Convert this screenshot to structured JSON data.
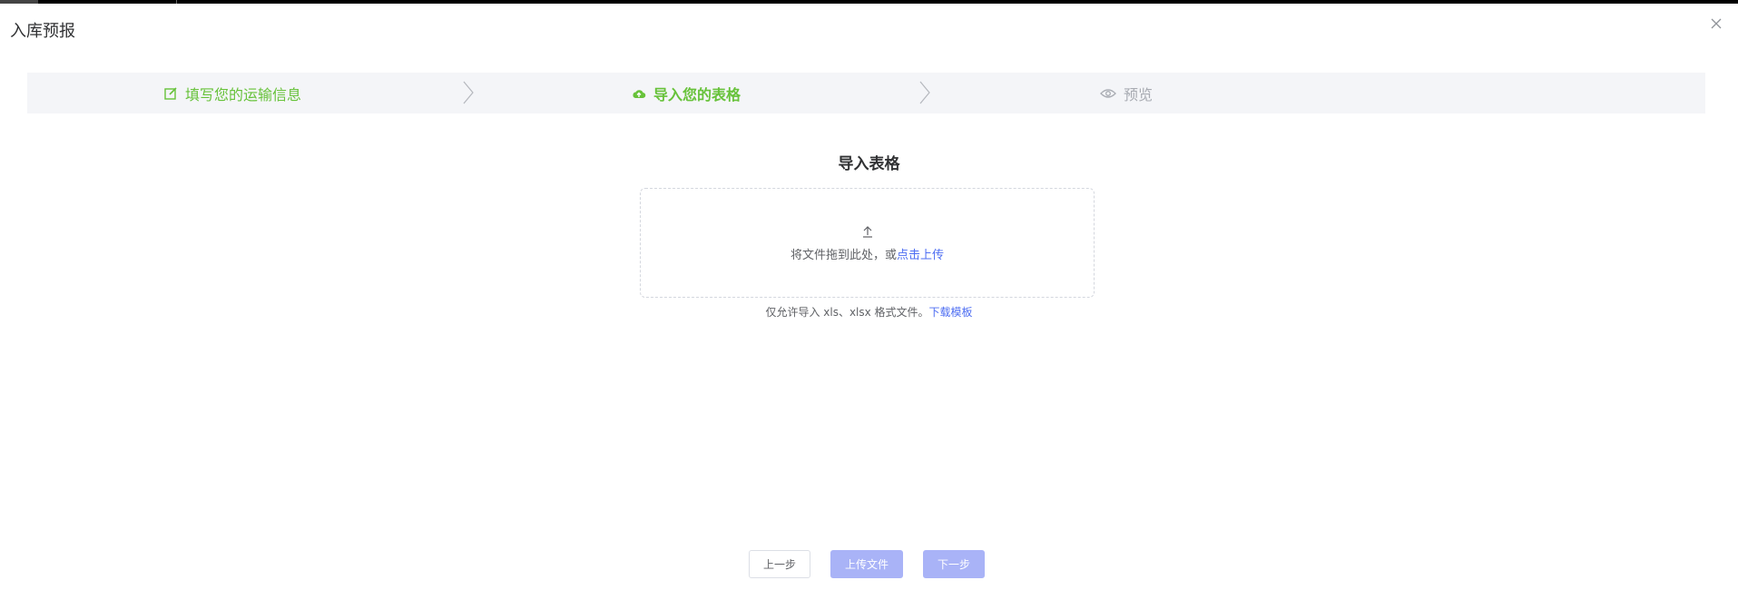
{
  "dialog": {
    "title": "入库预报"
  },
  "steps": [
    {
      "label": "填写您的运输信息",
      "icon": "edit-icon",
      "state": "done"
    },
    {
      "label": "导入您的表格",
      "icon": "cloud-upload-icon",
      "state": "active"
    },
    {
      "label": "预览",
      "icon": "eye-icon",
      "state": "pending"
    }
  ],
  "upload": {
    "section_title": "导入表格",
    "drop_text": "将文件拖到此处，或",
    "click_upload": "点击上传",
    "hint_text": "仅允许导入 xls、xlsx 格式文件。",
    "download_template": "下载模板"
  },
  "buttons": {
    "prev": "上一步",
    "upload": "上传文件",
    "next": "下一步"
  },
  "colors": {
    "success": "#67c23a",
    "pending": "#a8abb2",
    "link": "#4e6ef2",
    "primary_disabled": "#a9b3f7"
  }
}
